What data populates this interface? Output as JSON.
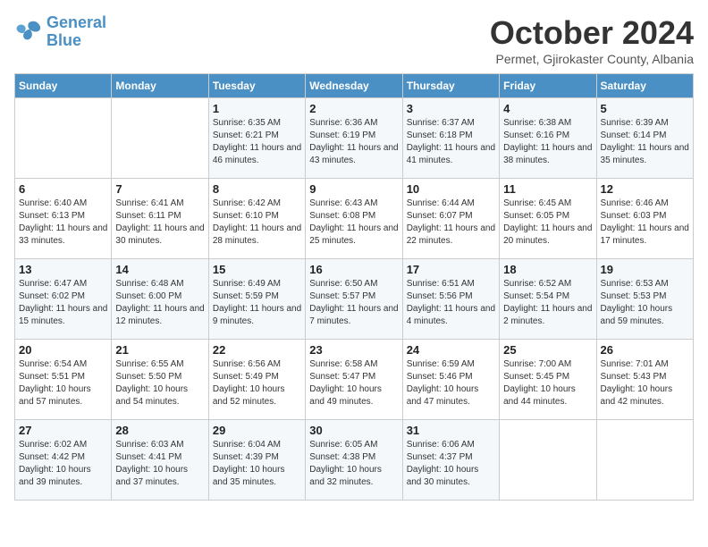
{
  "logo": {
    "line1": "General",
    "line2": "Blue"
  },
  "title": "October 2024",
  "subtitle": "Permet, Gjirokaster County, Albania",
  "days_header": [
    "Sunday",
    "Monday",
    "Tuesday",
    "Wednesday",
    "Thursday",
    "Friday",
    "Saturday"
  ],
  "weeks": [
    [
      {
        "day": "",
        "info": ""
      },
      {
        "day": "",
        "info": ""
      },
      {
        "day": "1",
        "info": "Sunrise: 6:35 AM\nSunset: 6:21 PM\nDaylight: 11 hours and 46 minutes."
      },
      {
        "day": "2",
        "info": "Sunrise: 6:36 AM\nSunset: 6:19 PM\nDaylight: 11 hours and 43 minutes."
      },
      {
        "day": "3",
        "info": "Sunrise: 6:37 AM\nSunset: 6:18 PM\nDaylight: 11 hours and 41 minutes."
      },
      {
        "day": "4",
        "info": "Sunrise: 6:38 AM\nSunset: 6:16 PM\nDaylight: 11 hours and 38 minutes."
      },
      {
        "day": "5",
        "info": "Sunrise: 6:39 AM\nSunset: 6:14 PM\nDaylight: 11 hours and 35 minutes."
      }
    ],
    [
      {
        "day": "6",
        "info": "Sunrise: 6:40 AM\nSunset: 6:13 PM\nDaylight: 11 hours and 33 minutes."
      },
      {
        "day": "7",
        "info": "Sunrise: 6:41 AM\nSunset: 6:11 PM\nDaylight: 11 hours and 30 minutes."
      },
      {
        "day": "8",
        "info": "Sunrise: 6:42 AM\nSunset: 6:10 PM\nDaylight: 11 hours and 28 minutes."
      },
      {
        "day": "9",
        "info": "Sunrise: 6:43 AM\nSunset: 6:08 PM\nDaylight: 11 hours and 25 minutes."
      },
      {
        "day": "10",
        "info": "Sunrise: 6:44 AM\nSunset: 6:07 PM\nDaylight: 11 hours and 22 minutes."
      },
      {
        "day": "11",
        "info": "Sunrise: 6:45 AM\nSunset: 6:05 PM\nDaylight: 11 hours and 20 minutes."
      },
      {
        "day": "12",
        "info": "Sunrise: 6:46 AM\nSunset: 6:03 PM\nDaylight: 11 hours and 17 minutes."
      }
    ],
    [
      {
        "day": "13",
        "info": "Sunrise: 6:47 AM\nSunset: 6:02 PM\nDaylight: 11 hours and 15 minutes."
      },
      {
        "day": "14",
        "info": "Sunrise: 6:48 AM\nSunset: 6:00 PM\nDaylight: 11 hours and 12 minutes."
      },
      {
        "day": "15",
        "info": "Sunrise: 6:49 AM\nSunset: 5:59 PM\nDaylight: 11 hours and 9 minutes."
      },
      {
        "day": "16",
        "info": "Sunrise: 6:50 AM\nSunset: 5:57 PM\nDaylight: 11 hours and 7 minutes."
      },
      {
        "day": "17",
        "info": "Sunrise: 6:51 AM\nSunset: 5:56 PM\nDaylight: 11 hours and 4 minutes."
      },
      {
        "day": "18",
        "info": "Sunrise: 6:52 AM\nSunset: 5:54 PM\nDaylight: 11 hours and 2 minutes."
      },
      {
        "day": "19",
        "info": "Sunrise: 6:53 AM\nSunset: 5:53 PM\nDaylight: 10 hours and 59 minutes."
      }
    ],
    [
      {
        "day": "20",
        "info": "Sunrise: 6:54 AM\nSunset: 5:51 PM\nDaylight: 10 hours and 57 minutes."
      },
      {
        "day": "21",
        "info": "Sunrise: 6:55 AM\nSunset: 5:50 PM\nDaylight: 10 hours and 54 minutes."
      },
      {
        "day": "22",
        "info": "Sunrise: 6:56 AM\nSunset: 5:49 PM\nDaylight: 10 hours and 52 minutes."
      },
      {
        "day": "23",
        "info": "Sunrise: 6:58 AM\nSunset: 5:47 PM\nDaylight: 10 hours and 49 minutes."
      },
      {
        "day": "24",
        "info": "Sunrise: 6:59 AM\nSunset: 5:46 PM\nDaylight: 10 hours and 47 minutes."
      },
      {
        "day": "25",
        "info": "Sunrise: 7:00 AM\nSunset: 5:45 PM\nDaylight: 10 hours and 44 minutes."
      },
      {
        "day": "26",
        "info": "Sunrise: 7:01 AM\nSunset: 5:43 PM\nDaylight: 10 hours and 42 minutes."
      }
    ],
    [
      {
        "day": "27",
        "info": "Sunrise: 6:02 AM\nSunset: 4:42 PM\nDaylight: 10 hours and 39 minutes."
      },
      {
        "day": "28",
        "info": "Sunrise: 6:03 AM\nSunset: 4:41 PM\nDaylight: 10 hours and 37 minutes."
      },
      {
        "day": "29",
        "info": "Sunrise: 6:04 AM\nSunset: 4:39 PM\nDaylight: 10 hours and 35 minutes."
      },
      {
        "day": "30",
        "info": "Sunrise: 6:05 AM\nSunset: 4:38 PM\nDaylight: 10 hours and 32 minutes."
      },
      {
        "day": "31",
        "info": "Sunrise: 6:06 AM\nSunset: 4:37 PM\nDaylight: 10 hours and 30 minutes."
      },
      {
        "day": "",
        "info": ""
      },
      {
        "day": "",
        "info": ""
      }
    ]
  ]
}
